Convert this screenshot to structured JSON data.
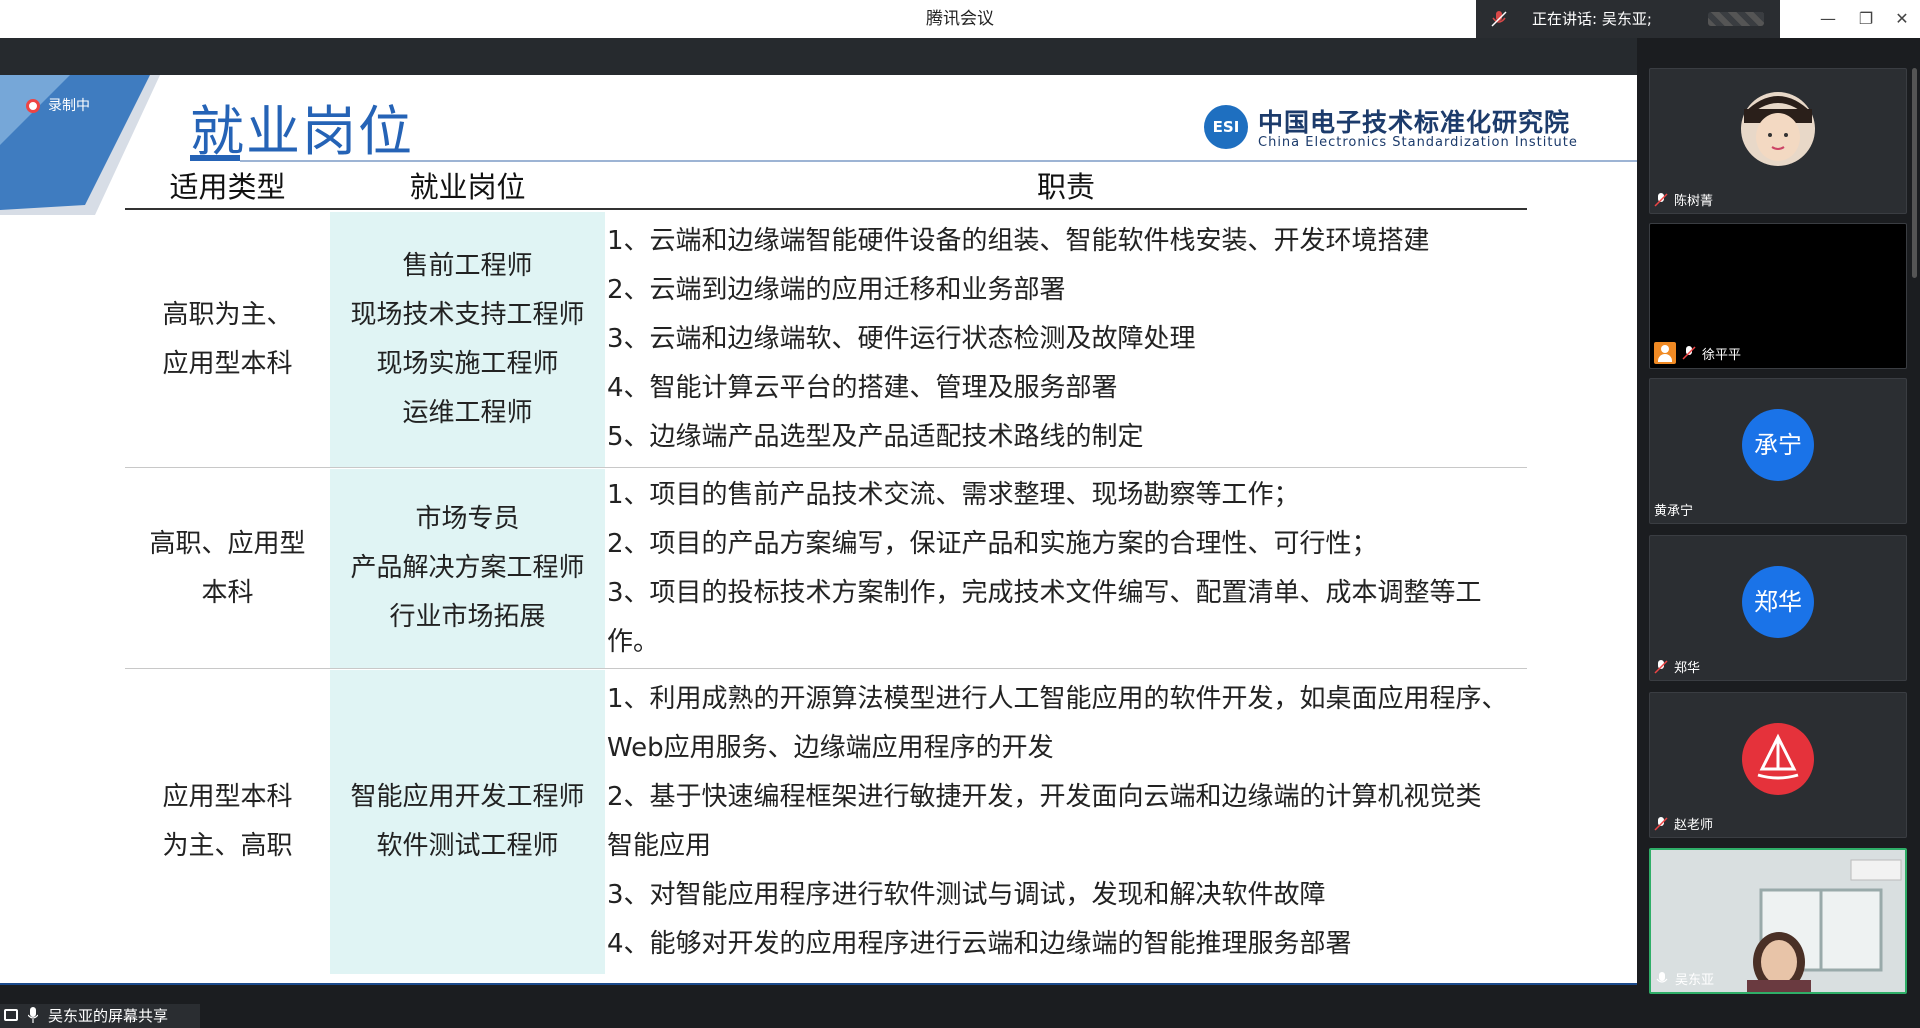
{
  "window": {
    "title": "腾讯会议",
    "speaking": "正在讲话: 吴东亚;",
    "minimize": "—",
    "restore": "❐",
    "close": "✕"
  },
  "recording": {
    "label": "录制中"
  },
  "slide": {
    "title": "就业岗位",
    "logo": {
      "mark": "ESI",
      "cn": "中国电子技术标准化研究院",
      "en": "China Electronics Standardization Institute"
    },
    "table": {
      "headers": [
        "适用类型",
        "就业岗位",
        "职责"
      ],
      "rows": [
        {
          "type": [
            "高职为主、",
            "应用型本科"
          ],
          "positions": [
            "售前工程师",
            "现场技术支持工程师",
            "现场实施工程师",
            "运维工程师"
          ],
          "duties": [
            "1、云端和边缘端智能硬件设备的组装、智能软件栈安装、开发环境搭建",
            "2、云端到边缘端的应用迁移和业务部署",
            "3、云端和边缘端软、硬件运行状态检测及故障处理",
            "4、智能计算云平台的搭建、管理及服务部署",
            "5、边缘端产品选型及产品适配技术路线的制定"
          ]
        },
        {
          "type": [
            "高职、应用型",
            "本科"
          ],
          "positions": [
            "市场专员",
            "产品解决方案工程师",
            "行业市场拓展"
          ],
          "duties": [
            "1、项目的售前产品技术交流、需求整理、现场勘察等工作；",
            "2、项目的产品方案编写，保证产品和实施方案的合理性、可行性；",
            "3、项目的投标技术方案制作，完成技术文件编写、配置清单、成本调整等工",
            "作。"
          ]
        },
        {
          "type": [
            "应用型本科",
            "为主、高职"
          ],
          "positions": [
            "智能应用开发工程师",
            "软件测试工程师"
          ],
          "duties": [
            "1、利用成熟的开源算法模型进行人工智能应用的软件开发，如桌面应用程序、",
            "Web应用服务、边缘端应用程序的开发",
            "2、基于快速编程框架进行敏捷开发，开发面向云端和边缘端的计算机视觉类",
            "智能应用",
            "3、对智能应用程序进行软件测试与调试，发现和解决软件故障",
            "4、能够对开发的应用程序进行云端和边缘端的智能推理服务部署"
          ]
        }
      ]
    }
  },
  "share": {
    "label": "吴东亚的屏幕共享"
  },
  "participants": [
    {
      "name": "陈树菁",
      "kind": "photo"
    },
    {
      "name": "徐平平",
      "kind": "black"
    },
    {
      "name": "黄承宁",
      "kind": "avatar",
      "initials": "承宁",
      "color": "#1a73e8"
    },
    {
      "name": "郑华",
      "kind": "avatar",
      "initials": "郑华",
      "color": "#1a73e8"
    },
    {
      "name": "赵老师",
      "kind": "avatar",
      "initials": "⛵",
      "color": "#e5323b"
    },
    {
      "name": "吴东亚",
      "kind": "video"
    }
  ]
}
